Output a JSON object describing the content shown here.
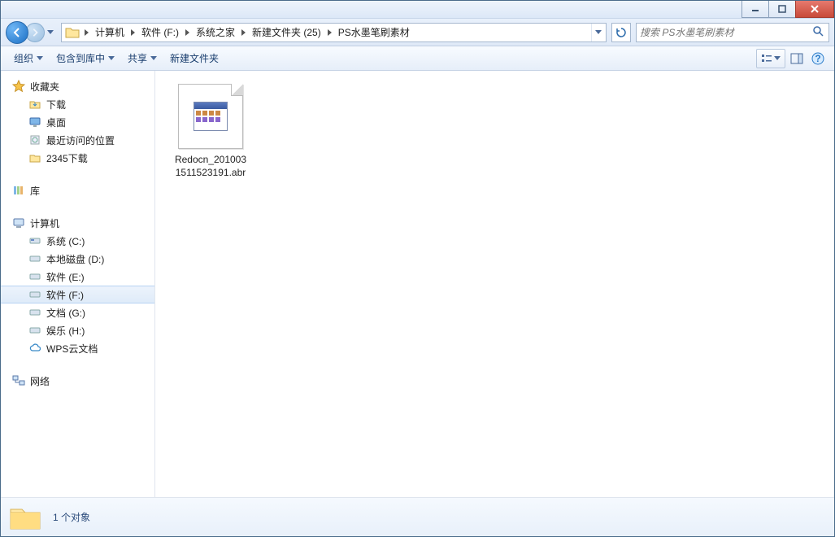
{
  "breadcrumbs": [
    "计算机",
    "软件 (F:)",
    "系统之家",
    "新建文件夹 (25)",
    "PS水墨笔刷素材"
  ],
  "search": {
    "placeholder": "搜索 PS水墨笔刷素材"
  },
  "toolbar": {
    "organize": "组织",
    "include": "包含到库中",
    "share": "共享",
    "new_folder": "新建文件夹"
  },
  "sidebar": {
    "favorites": {
      "label": "收藏夹",
      "items": [
        "下载",
        "桌面",
        "最近访问的位置",
        "2345下载"
      ]
    },
    "libraries": {
      "label": "库"
    },
    "computer": {
      "label": "计算机",
      "drives": [
        "系统 (C:)",
        "本地磁盘 (D:)",
        "软件 (E:)",
        "软件 (F:)",
        "文档 (G:)",
        "娱乐 (H:)",
        "WPS云文档"
      ],
      "selected_index": 3
    },
    "network": {
      "label": "网络"
    }
  },
  "files": [
    {
      "name_line1": "Redocn_201003",
      "name_line2": "1511523191.abr"
    }
  ],
  "details": {
    "count_label": "1 个对象"
  }
}
